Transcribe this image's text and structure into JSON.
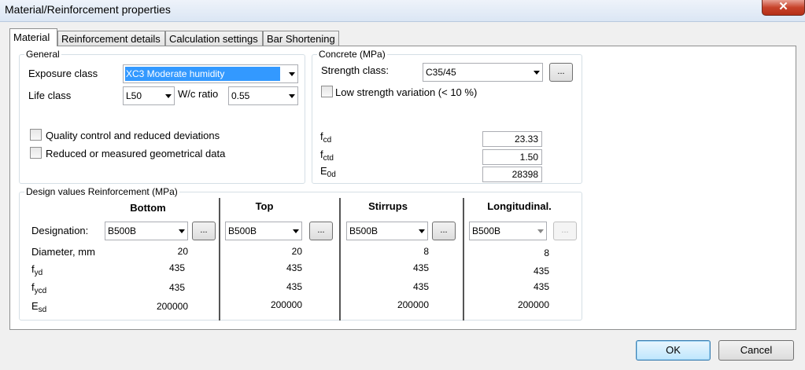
{
  "window": {
    "title": "Material/Reinforcement properties",
    "close_label": "✕"
  },
  "tabs": [
    {
      "label": "Material",
      "active": true
    },
    {
      "label": "Reinforcement details"
    },
    {
      "label": "Calculation settings"
    },
    {
      "label": "Bar Shortening"
    }
  ],
  "general": {
    "group_label": "General",
    "exposure_class_label": "Exposure class",
    "exposure_class_value": "XC3 Moderate humidity",
    "life_class_label": "Life class",
    "life_class_value": "L50",
    "wc_ratio_label": "W/c ratio",
    "wc_ratio_value": "0.55",
    "quality_control_label": "Quality control and reduced deviations",
    "reduced_geometry_label": "Reduced or measured geometrical data"
  },
  "concrete": {
    "group_label": "Concrete (MPa)",
    "strength_class_label": "Strength class:",
    "strength_class_value": "C35/45",
    "low_strength_label": "Low strength variation (< 10 %)",
    "fcd": {
      "sym": "f",
      "sub": "cd",
      "value": "23.33"
    },
    "fctd": {
      "sym": "f",
      "sub": "ctd",
      "value": "1.50"
    },
    "e0d": {
      "sym": "E",
      "sub": "0d",
      "value": "28398"
    }
  },
  "reinforcement": {
    "group_label": "Design values Reinforcement (MPa)",
    "row_labels": {
      "designation": "Designation:",
      "diameter": "Diameter, mm",
      "fyd": {
        "sym": "f",
        "sub": "yd"
      },
      "fycd": {
        "sym": "f",
        "sub": "ycd"
      },
      "esd": {
        "sym": "E",
        "sub": "sd"
      }
    },
    "columns": [
      {
        "header": "Bottom",
        "designation": "B500B",
        "diameter": "20",
        "fyd": "435",
        "fycd": "435",
        "esd": "200000"
      },
      {
        "header": "Top",
        "designation": "B500B",
        "diameter": "20",
        "fyd": "435",
        "fycd": "435",
        "esd": "200000"
      },
      {
        "header": "Stirrups",
        "designation": "B500B",
        "diameter": "8",
        "fyd": "435",
        "fycd": "435",
        "esd": "200000"
      },
      {
        "header": "Longitudinal.",
        "designation": "B500B",
        "diameter": "8",
        "fyd": "435",
        "fycd": "435",
        "esd": "200000"
      }
    ]
  },
  "browse_label": "...",
  "buttons": {
    "ok": "OK",
    "cancel": "Cancel"
  }
}
